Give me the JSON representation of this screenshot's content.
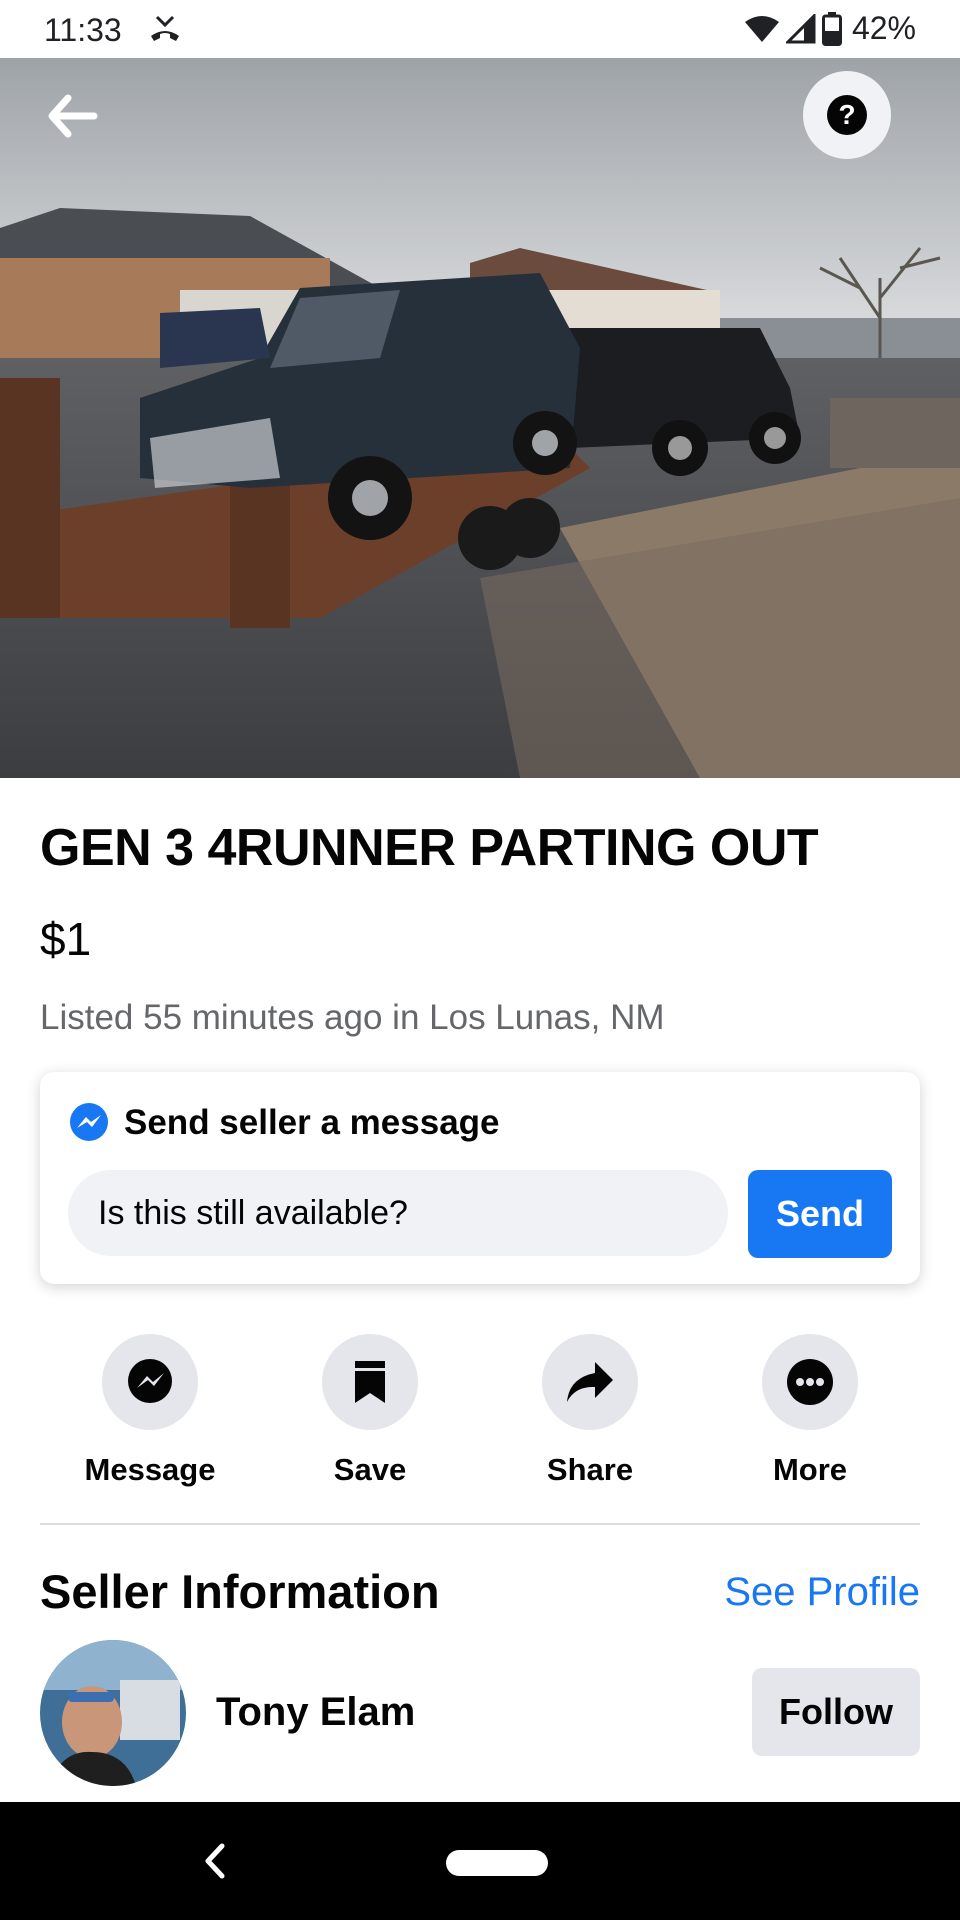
{
  "status_bar": {
    "time": "11:33",
    "battery": "42%",
    "icons": [
      "missed-call-icon",
      "wifi-icon",
      "signal-icon",
      "battery-icon"
    ]
  },
  "hero": {
    "photo_count": 6,
    "active_photo_index": 0,
    "icons": [
      "back-arrow-icon",
      "help-icon"
    ]
  },
  "listing": {
    "title": "GEN 3 4RUNNER PARTING OUT",
    "price": "$1",
    "listed": "Listed 55 minutes ago in Los Lunas, NM"
  },
  "message_card": {
    "header": "Send seller a message",
    "input_value": "Is this still available?",
    "send_label": "Send",
    "icon": "messenger-icon"
  },
  "actions": [
    {
      "label": "Message",
      "icon": "messenger-icon"
    },
    {
      "label": "Save",
      "icon": "bookmark-icon"
    },
    {
      "label": "Share",
      "icon": "share-arrow-icon"
    },
    {
      "label": "More",
      "icon": "more-dots-icon"
    }
  ],
  "seller": {
    "heading": "Seller Information",
    "see_profile": "See Profile",
    "name": "Tony Elam",
    "follow_label": "Follow"
  },
  "colors": {
    "accent": "#1877f2",
    "button_gray": "#e4e6eb",
    "secondary_text": "#65676b"
  }
}
